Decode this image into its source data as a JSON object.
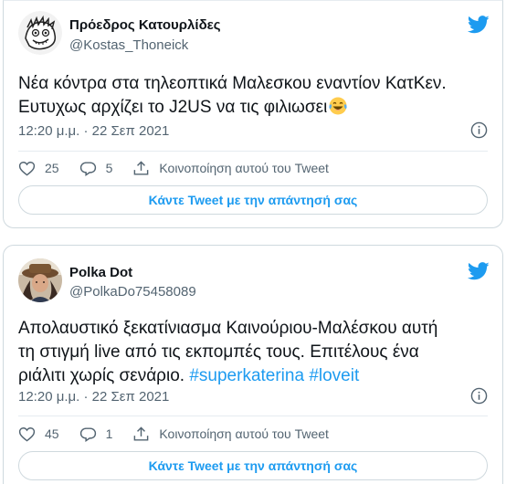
{
  "tweets": [
    {
      "author_name": "Πρόεδρος Κατουρλίδες",
      "author_handle": "@Kostas_Thoneick",
      "text_line1": "Νέα κόντρα στα τηλεοπτικά Μαλεσκου εναντίον ΚατΚεν.",
      "text_line2": "Ευτυχως αρχίζει το J2US να τις φιλιωσει",
      "emoji": "face-with-tears-of-joy",
      "timestamp": "12:20 μ.μ. · 22 Σεπ 2021",
      "likes": "25",
      "replies": "5",
      "share_label": "Κοινοποίηση αυτού του Tweet",
      "reply_button": "Κάντε Tweet με την απάντησή σας"
    },
    {
      "author_name": "Polka Dot",
      "author_handle": "@PolkaDo75458089",
      "text_line1": "Απολαυστικό ξεκατίνιασμα Καινούριου-Μαλέσκου αυτή",
      "text_line2": "τη στιγμή live από τις εκπομπές τους. Επιτέλους ένα",
      "text_line3": "ριάλιτι χωρίς σενάριο.",
      "hashtag1": "#superkaterina",
      "hashtag2": "#loveit",
      "timestamp": "12:20 μ.μ. · 22 Σεπ 2021",
      "likes": "45",
      "replies": "1",
      "share_label": "Κοινοποίηση αυτού του Tweet",
      "reply_button": "Κάντε Tweet με την απάντησή σας"
    }
  ],
  "colors": {
    "brand": "#1d9bf0",
    "text": "#0f1419",
    "secondary": "#536471",
    "border": "#cfd9de"
  }
}
